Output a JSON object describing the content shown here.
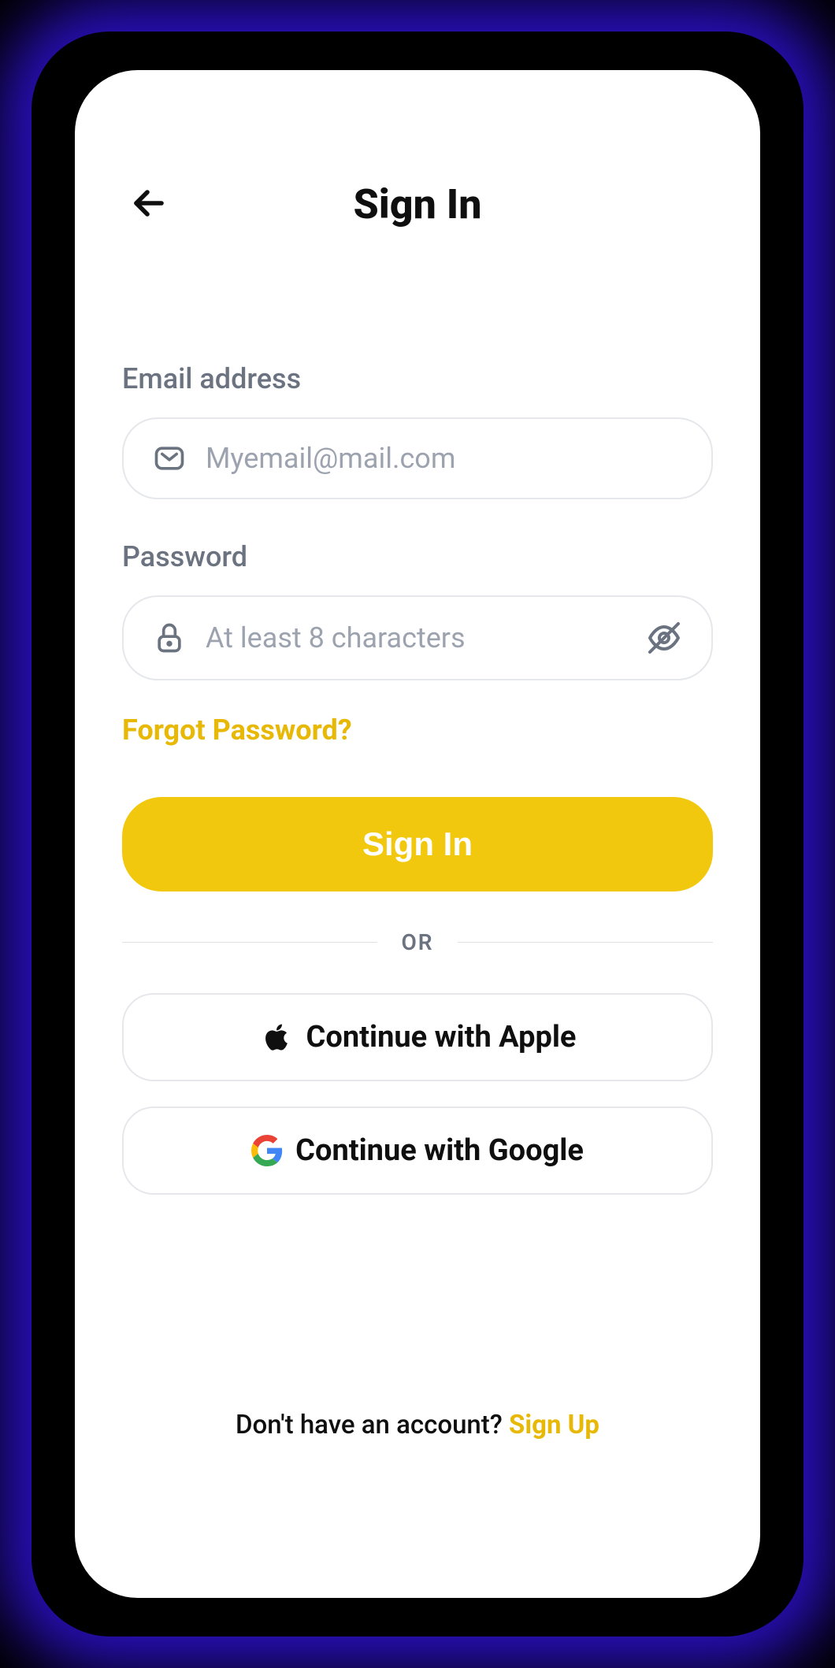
{
  "header": {
    "title": "Sign In"
  },
  "email": {
    "label": "Email address",
    "placeholder": "Myemail@mail.com"
  },
  "password": {
    "label": "Password",
    "placeholder": "At least 8 characters"
  },
  "links": {
    "forgot": "Forgot Password?"
  },
  "buttons": {
    "signin": "Sign In",
    "apple": "Continue with Apple",
    "google": "Continue with Google"
  },
  "divider": "OR",
  "footer": {
    "prompt": "Don't have an account? ",
    "signup": "Sign Up"
  }
}
